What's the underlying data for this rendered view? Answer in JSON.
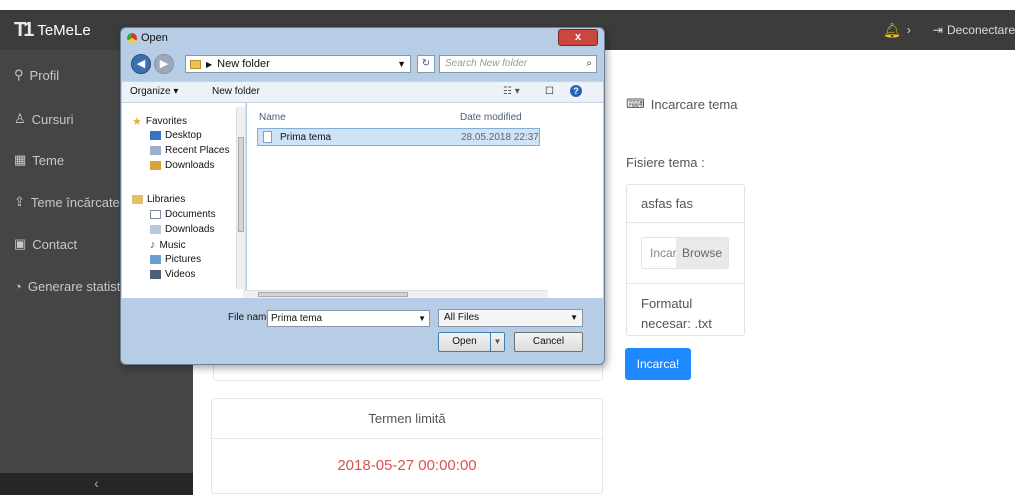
{
  "app": {
    "brand": "TeMeLe",
    "logo_text": "T1"
  },
  "topbar": {
    "logout_label": "Deconectare",
    "chevron": "›"
  },
  "sidebar": {
    "items": [
      {
        "label": "Profil",
        "icon": "⚲"
      },
      {
        "label": "Cursuri",
        "icon": "♙"
      },
      {
        "label": "Teme",
        "icon": "▦"
      },
      {
        "label": "Teme încărcate",
        "icon": "⇪"
      },
      {
        "label": "Contact",
        "icon": "▣"
      },
      {
        "label": "Generare statistici",
        "icon": "◔"
      }
    ],
    "footer_icon": "‹"
  },
  "main": {
    "upload_title": "Incarcare tema",
    "files_label": "Fisiere tema :",
    "file_entry": "asfas fas",
    "file_input_text": "Incarca",
    "browse_label": "Browse",
    "format_note": "Formatul necesar: .txt",
    "upload_button": "Incarca!",
    "deadline_label": "Termen limită",
    "deadline_value": "2018-05-27 00:00:00"
  },
  "dialog": {
    "title": "Open",
    "close": "x",
    "address": "New folder",
    "search_placeholder": "Search New folder",
    "toolbar": {
      "organize": "Organize ▾",
      "new_folder": "New folder"
    },
    "nav": {
      "favorites": "Favorites",
      "desktop": "Desktop",
      "recent": "Recent Places",
      "downloads": "Downloads",
      "libraries": "Libraries",
      "documents": "Documents",
      "lib_downloads": "Downloads",
      "music": "Music",
      "pictures": "Pictures",
      "videos": "Videos"
    },
    "columns": {
      "name": "Name",
      "date": "Date modified"
    },
    "file": {
      "name": "Prima tema",
      "date": "28.05.2018 22:37"
    },
    "file_name_label": "File name:",
    "file_name_value": "Prima tema",
    "file_type": "All Files",
    "open_button": "Open",
    "cancel_button": "Cancel"
  },
  "colors": {
    "topbar": "#3c3c3c",
    "sidebar": "#454545",
    "primary": "#1e88ff",
    "deadline": "#d9534f",
    "bell": "#f0c419"
  }
}
